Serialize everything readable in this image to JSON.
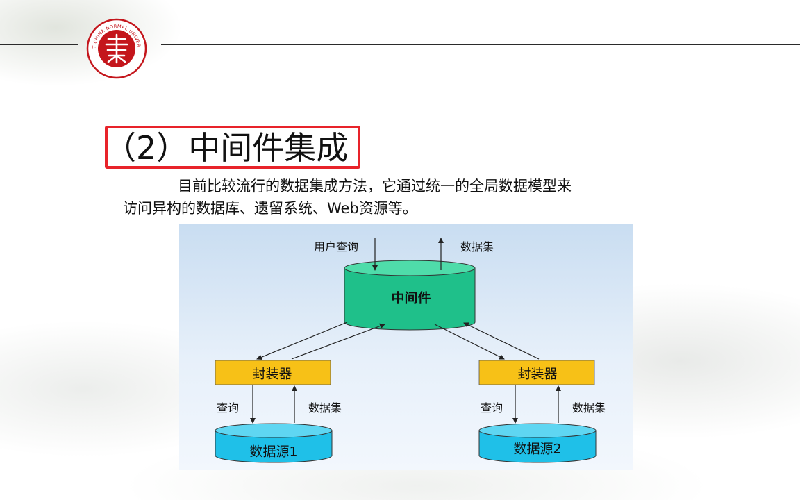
{
  "slide": {
    "title": "（2）中间件集成",
    "paragraph_line1": "目前比较流行的数据集成方法，它通过统一的全局数据模型来",
    "paragraph_line2": "访问异构的数据库、遗留系统、Web资源等。"
  },
  "logo": {
    "text": "EAST CHINA NORMAL UNIVERSITY",
    "icon": "university-seal-icon",
    "color": "#c4161c"
  },
  "diagram": {
    "middleware": "中间件",
    "user_query": "用户查询",
    "dataset_top": "数据集",
    "wrapper_left": "封装器",
    "wrapper_right": "封装器",
    "query_left": "查询",
    "dataset_left": "数据集",
    "query_right": "查询",
    "dataset_right": "数据集",
    "source_1": "数据源1",
    "source_2": "数据源2",
    "colors": {
      "middleware": "#1fc08a",
      "wrapper": "#f7c117",
      "source": "#1fc0e8",
      "highlight": "#e8232a"
    }
  }
}
